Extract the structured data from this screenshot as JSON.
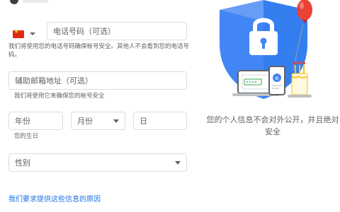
{
  "phone": {
    "country": "中国",
    "placeholder": "电话号码（可选）",
    "hint": "我们将使用您的电话号码确保帐号安全。其他人不会看到您的电话号码。"
  },
  "recovery_email": {
    "placeholder": "辅助邮箱地址（可选）",
    "hint": "我们将使用它来确保您的帐号安全"
  },
  "birthday": {
    "year_placeholder": "年份",
    "month_placeholder": "月份",
    "day_placeholder": "日",
    "hint": "您的生日"
  },
  "gender": {
    "placeholder": "性别"
  },
  "reason_link": "我们要求提供这些信息的原因",
  "privacy_caption": "您的个人信息不会对外公开，并且绝对安全",
  "colors": {
    "shield": "#4285f4",
    "shield_light": "#aecbfa",
    "balloon": "#ea4335",
    "link": "#1a73e8"
  }
}
